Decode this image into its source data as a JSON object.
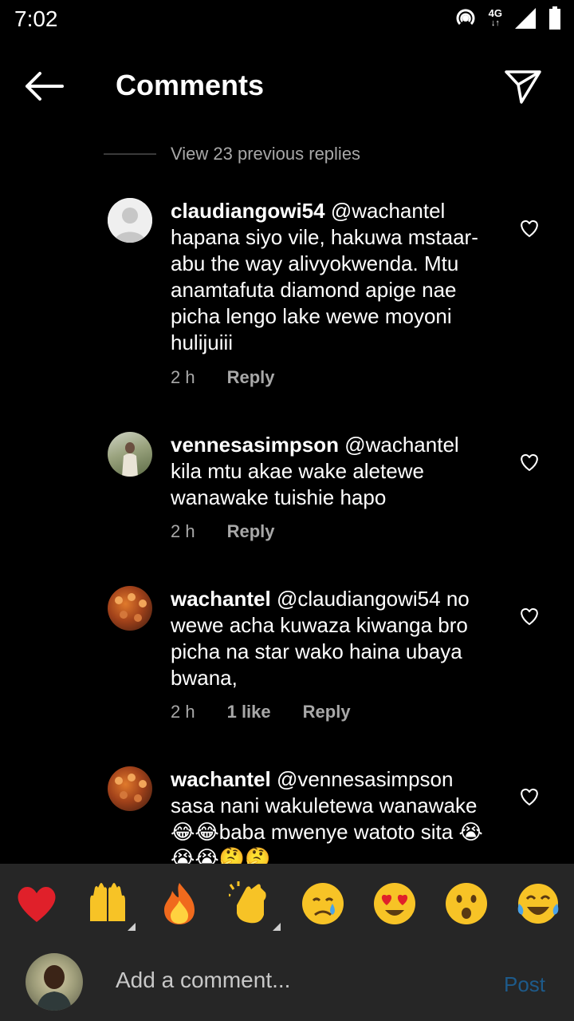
{
  "status_bar": {
    "time": "7:02",
    "network": "4G"
  },
  "header": {
    "title": "Comments"
  },
  "previous_replies": {
    "label": "View 23 previous replies"
  },
  "comments": [
    {
      "username": "claudiangowi54",
      "text": "@wachantel hapana siyo vile, hakuwa mstaar-abu the way alivyokwenda. Mtu anamtafuta diamond apige nae picha lengo lake wewe moyoni hulijuiii",
      "time": "2 h",
      "likes": "",
      "reply_label": "Reply"
    },
    {
      "username": "vennesasimpson",
      "text": "@wachantel kila mtu akae wake aletewe wanawake tuishie hapo",
      "time": "2 h",
      "likes": "",
      "reply_label": "Reply"
    },
    {
      "username": "wachantel",
      "text": "@claudiangowi54 no wewe acha kuwaza kiwanga bro picha na star wako haina ubaya bwana,",
      "time": "2 h",
      "likes": "1 like",
      "reply_label": "Reply"
    },
    {
      "username": "wachantel",
      "text": "@vennesasimpson sasa nani wakuletewa wanawake 😂😂baba mwenye watoto sita 😭😭😭🤔🤔",
      "time": "",
      "likes": "",
      "reply_label": ""
    }
  ],
  "reactions": [
    "❤️",
    "🙌",
    "🔥",
    "👏",
    "😢",
    "😍",
    "😮",
    "😂"
  ],
  "composer": {
    "placeholder": "Add a comment...",
    "post_label": "Post"
  }
}
